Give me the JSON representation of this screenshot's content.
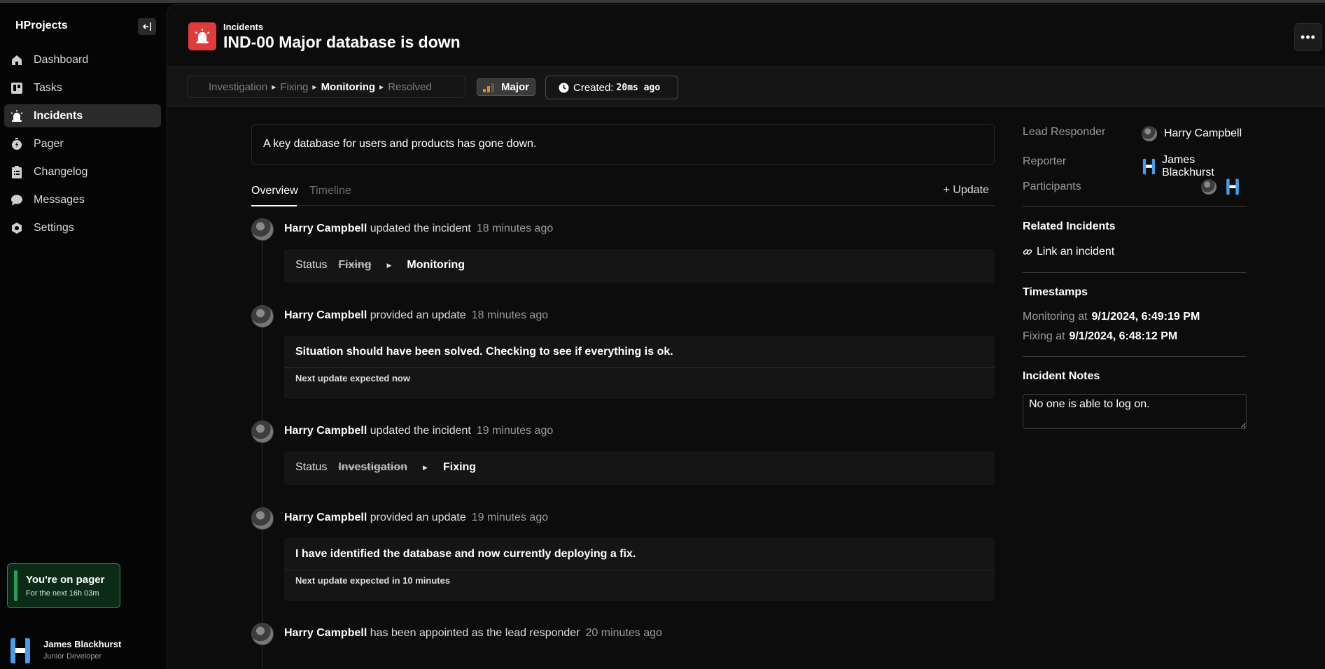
{
  "app": {
    "name": "HProjects"
  },
  "sidebar": {
    "items": [
      {
        "label": "Dashboard",
        "icon": "home-icon"
      },
      {
        "label": "Tasks",
        "icon": "board-icon"
      },
      {
        "label": "Incidents",
        "icon": "siren-icon",
        "active": true
      },
      {
        "label": "Pager",
        "icon": "stopwatch-icon"
      },
      {
        "label": "Changelog",
        "icon": "clipboard-icon"
      },
      {
        "label": "Messages",
        "icon": "chat-icon"
      },
      {
        "label": "Settings",
        "icon": "gear-icon"
      }
    ],
    "pager": {
      "title": "You're on pager",
      "subtitle": "For the next 16h 03m"
    },
    "user": {
      "name": "James Blackhurst",
      "role": "Junior Developer"
    }
  },
  "header": {
    "breadcrumb": "Incidents",
    "title": "IND-00 Major database is down"
  },
  "statusbar": {
    "steps": [
      "Investigation",
      "Fixing",
      "Monitoring",
      "Resolved"
    ],
    "current_step": "Monitoring",
    "severity": "Major",
    "created_label": "Created:",
    "created_value": "20ms ago"
  },
  "description": "A key database for users and products has gone down.",
  "tabs": {
    "overview": "Overview",
    "timeline": "Timeline",
    "update_button": "+ Update"
  },
  "timeline": [
    {
      "actor": "Harry Campbell",
      "action": "updated the incident",
      "ago": "18 minutes ago",
      "status_label": "Status",
      "from": "Fixing",
      "to": "Monitoring"
    },
    {
      "actor": "Harry Campbell",
      "action": "provided an update",
      "ago": "18 minutes ago",
      "message": "Situation should have been solved. Checking to see if everything is ok.",
      "next": "Next update expected now"
    },
    {
      "actor": "Harry Campbell",
      "action": "updated the incident",
      "ago": "19 minutes ago",
      "status_label": "Status",
      "from": "Investigation",
      "to": "Fixing"
    },
    {
      "actor": "Harry Campbell",
      "action": "provided an update",
      "ago": "19 minutes ago",
      "message": "I have identified the database and now currently deploying a fix.",
      "next": "Next update expected in 10 minutes"
    },
    {
      "actor": "Harry Campbell",
      "action": "has been appointed as the lead responder",
      "ago": "20 minutes ago"
    }
  ],
  "details": {
    "lead_label": "Lead Responder",
    "lead_value": "Harry Campbell",
    "reporter_label": "Reporter",
    "reporter_value": "James Blackhurst",
    "participants_label": "Participants",
    "related_title": "Related Incidents",
    "link_label": "Link an incident",
    "timestamps_title": "Timestamps",
    "ts_monitoring_label": "Monitoring at",
    "ts_monitoring_value": "9/1/2024, 6:49:19 PM",
    "ts_fixing_label": "Fixing at",
    "ts_fixing_value": "9/1/2024, 6:48:12 PM",
    "notes_title": "Incident Notes",
    "notes_value": "No one is able to log on."
  },
  "colors": {
    "accent_red": "#e23b3b",
    "pager_green": "#2f9c55",
    "severity_orange": "#e0862a",
    "brand_blue": "#4a9be8"
  }
}
